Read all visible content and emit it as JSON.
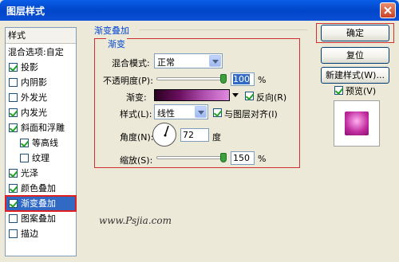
{
  "window": {
    "title": "图层样式"
  },
  "sidebar": {
    "header": "样式",
    "blend_options": "混合选项:自定",
    "items": [
      {
        "label": "投影",
        "checked": true
      },
      {
        "label": "内阴影",
        "checked": false
      },
      {
        "label": "外发光",
        "checked": false
      },
      {
        "label": "内发光",
        "checked": true
      },
      {
        "label": "斜面和浮雕",
        "checked": true
      },
      {
        "label": "等高线",
        "checked": true
      },
      {
        "label": "纹理",
        "checked": false
      },
      {
        "label": "光泽",
        "checked": true
      },
      {
        "label": "颜色叠加",
        "checked": true
      },
      {
        "label": "渐变叠加",
        "checked": true,
        "selected": true
      },
      {
        "label": "图案叠加",
        "checked": false
      },
      {
        "label": "描边",
        "checked": false
      }
    ]
  },
  "panel": {
    "group_title": "渐变叠加",
    "sub_title": "渐变",
    "blend_mode_label": "混合模式:",
    "blend_mode_value": "正常",
    "opacity_label": "不透明度(P):",
    "opacity_value": "100",
    "opacity_unit": "%",
    "gradient_label": "渐变:",
    "reverse_label": "反向(R)",
    "reverse_checked": true,
    "style_label": "样式(L):",
    "style_value": "线性",
    "align_label": "与图层对齐(I)",
    "align_checked": true,
    "angle_label": "角度(N):",
    "angle_value": "72",
    "angle_unit": "度",
    "scale_label": "缩放(S):",
    "scale_value": "150",
    "scale_unit": "%"
  },
  "buttons": {
    "ok": "确定",
    "reset": "复位",
    "new_style": "新建样式(W)...",
    "preview_label": "预览(V)",
    "preview_checked": true
  },
  "watermark": "www.Psjia.com",
  "colors": {
    "selection": "#316ac5",
    "highlight_frame": "#d03030",
    "group_title": "#0046d5"
  }
}
